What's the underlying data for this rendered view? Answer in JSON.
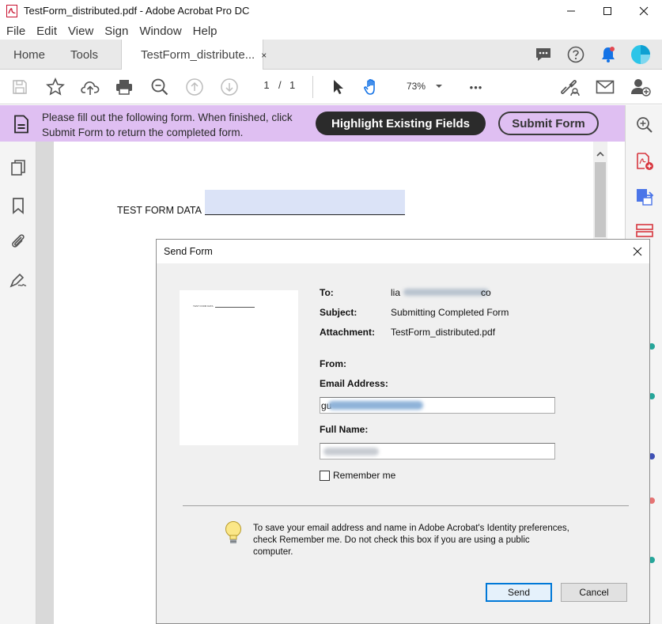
{
  "window": {
    "title": "TestForm_distributed.pdf - Adobe Acrobat Pro DC"
  },
  "menu": [
    "File",
    "Edit",
    "View",
    "Sign",
    "Window",
    "Help"
  ],
  "tabs": {
    "home": "Home",
    "tools": "Tools",
    "document": "TestForm_distribute...",
    "close_glyph": "×"
  },
  "toolbar": {
    "page_current": "1",
    "page_separator": "/",
    "page_total": "1",
    "zoom": "73%",
    "more": "•••"
  },
  "form_bar": {
    "message": "Please fill out the following form. When finished, click Submit Form to return the completed form.",
    "highlight_button": "Highlight Existing Fields",
    "submit_button": "Submit Form"
  },
  "document": {
    "field_label": "TEST FORM DATA"
  },
  "dialog": {
    "title": "Send Form",
    "to_label": "To:",
    "to_value": "lia",
    "to_value_tail": "co",
    "subject_label": "Subject:",
    "subject_value": "Submitting Completed Form",
    "attachment_label": "Attachment:",
    "attachment_value": "TestForm_distributed.pdf",
    "from_label": "From:",
    "email_label": "Email Address:",
    "email_value": "gu",
    "name_label": "Full Name:",
    "remember_label": "Remember me",
    "hint": "To save your email address and name in Adobe Acrobat's Identity preferences, check Remember me. Do not check this box if you are using a public computer.",
    "send_button": "Send",
    "cancel_button": "Cancel",
    "preview_text": "TEST FORM DATA"
  },
  "colors": {
    "form_bar": "#dfbff2",
    "highlight_button": "#2b2b2b",
    "field_fill": "#dbe3f7",
    "accent_blue": "#1473e6",
    "send_border": "#0078d7"
  }
}
